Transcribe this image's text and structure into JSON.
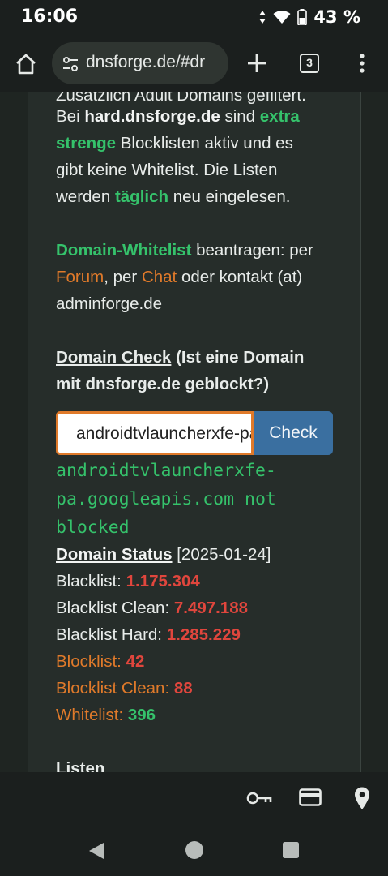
{
  "status": {
    "time": "16:06",
    "battery_pct": "43 %",
    "icons": [
      "data-arrows-icon",
      "wifi-icon",
      "battery-icon"
    ]
  },
  "browser": {
    "url": "dnsforge.de/#dr",
    "tab_count": "3",
    "icons": [
      "home-icon",
      "tune-icon",
      "plus-icon",
      "tabs-icon",
      "more-vert-icon"
    ]
  },
  "content": {
    "line0": "Zusätzlich Adult Domains gefiltert.",
    "p1": {
      "l1a": "Bei ",
      "l1b": "hard.dnsforge.de",
      "l1c": " sind ",
      "l1d": "extra",
      "l2a": "strenge",
      "l2b": " Blocklisten aktiv und es",
      "l3": "gibt keine Whitelist. Die Listen",
      "l4a": "werden ",
      "l4b": "täglich",
      "l4c": " neu eingelesen."
    },
    "p2": {
      "l1a": "Domain-Whitelist",
      "l1b": " beantragen: per",
      "l2a": "Forum",
      "l2b": ", per ",
      "l2c": "Chat",
      "l2d": " oder kontakt (at)",
      "l3": "adminforge.de"
    },
    "domain_check": {
      "heading_link": "Domain Check",
      "heading_rest1": " (Ist eine Domain",
      "heading_rest2": "mit dnsforge.de geblockt?)",
      "input_value": "androidtvlauncherxfe-pa.googleapis.com",
      "button_label": "Check",
      "result_l1": "androidtvlauncherxfe-",
      "result_l2": "pa.googleapis.com not",
      "result_l3": "blocked"
    },
    "domain_status": {
      "label": "Domain Status",
      "date": " [2025-01-24]",
      "rows": [
        {
          "label": "Blacklist: ",
          "value": "1.175.304"
        },
        {
          "label": "Blacklist Clean: ",
          "value": "7.497.188"
        },
        {
          "label": "Blacklist Hard: ",
          "value": "1.285.229"
        },
        {
          "label": "Blocklist: ",
          "value": "42"
        },
        {
          "label": "Blocklist Clean: ",
          "value": "88"
        },
        {
          "label": "Whitelist: ",
          "value": "396"
        }
      ]
    },
    "listen_heading": "Listen"
  },
  "bottom_toolbar": {
    "icons": [
      "key-icon",
      "credit-card-icon",
      "location-pin-icon"
    ]
  },
  "nav": {
    "icons": [
      "back-icon",
      "home-circle-icon",
      "recents-icon"
    ]
  },
  "colors": {
    "green": "#35c26b",
    "orange": "#e07a2a",
    "red": "#e0463d",
    "button_blue": "#3a6fa0"
  }
}
